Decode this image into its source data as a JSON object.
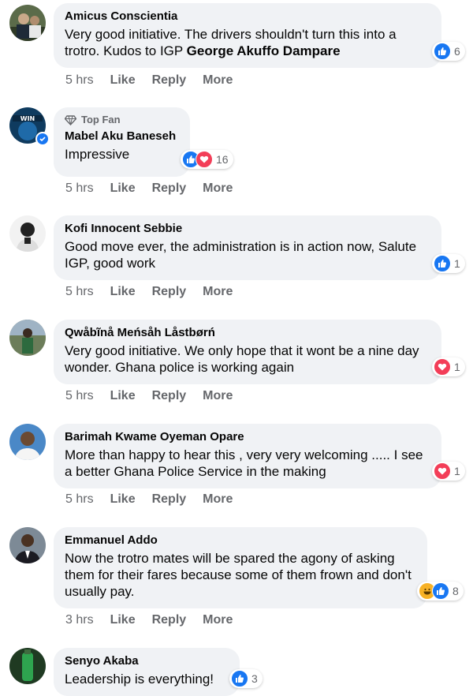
{
  "comments": [
    {
      "author": "Amicus Conscientia",
      "text_pre": "Very good initiative. The drivers shouldn't turn this into a trotro. Kudos to IGP ",
      "text_bold": "George Akuffo Dampare",
      "reactions": [
        "like"
      ],
      "reaction_count": "6",
      "time": "5 hrs"
    },
    {
      "badge": "Top Fan",
      "author": "Mabel Aku Baneseh",
      "text": "Impressive",
      "reactions": [
        "like",
        "love"
      ],
      "reaction_count": "16",
      "time": "5 hrs"
    },
    {
      "author": "Kofi Innocent Sebbie",
      "text": "Good move ever, the administration is in action now, Salute IGP, good work",
      "reactions": [
        "like"
      ],
      "reaction_count": "1",
      "time": "5 hrs"
    },
    {
      "author": "Qwåbĩnå Meńsåh Låstbørń",
      "text": "Very good initiative. We only hope that it wont be a nine day wonder. Ghana police is working again",
      "reactions": [
        "love"
      ],
      "reaction_count": "1",
      "time": "5 hrs"
    },
    {
      "author": "Barimah Kwame Oyeman Opare",
      "text": "More than happy to hear this , very very welcoming ..... I see a better Ghana Police Service in the making",
      "reactions": [
        "love"
      ],
      "reaction_count": "1",
      "time": "5 hrs"
    },
    {
      "author": "Emmanuel Addo",
      "text": "Now the trotro mates will be spared the agony of asking them for their fares because some of them frown and don't usually pay.",
      "reactions": [
        "haha",
        "like"
      ],
      "reaction_count": "8",
      "time": "3 hrs"
    },
    {
      "author": "Senyo Akaba",
      "text": "Leadership is everything!",
      "reactions": [
        "like"
      ],
      "reaction_count": "3"
    }
  ],
  "actions": {
    "like": "Like",
    "reply": "Reply",
    "more": "More"
  },
  "colors": {
    "like": "#1877f2",
    "love": "#f33e58",
    "haha": "#f7b125",
    "bubble": "#f0f2f5",
    "meta": "#65676b"
  }
}
